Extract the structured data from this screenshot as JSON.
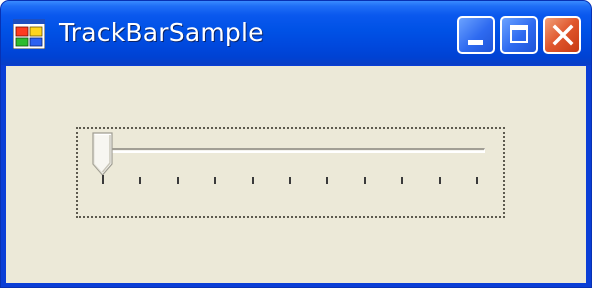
{
  "window": {
    "title": "TrackBarSample",
    "app_icon": "winforms-app-icon",
    "controls": {
      "minimize": "minimize-icon",
      "maximize": "maximize-icon",
      "close": "close-icon"
    }
  },
  "trackbar": {
    "minimum": 0,
    "maximum": 10,
    "value": 0,
    "tick_count": 11,
    "orientation": "horizontal",
    "focused": true
  },
  "colors": {
    "titlebar": "#0052e6",
    "client_background": "#ece9d8",
    "close_button": "#e0562c"
  }
}
